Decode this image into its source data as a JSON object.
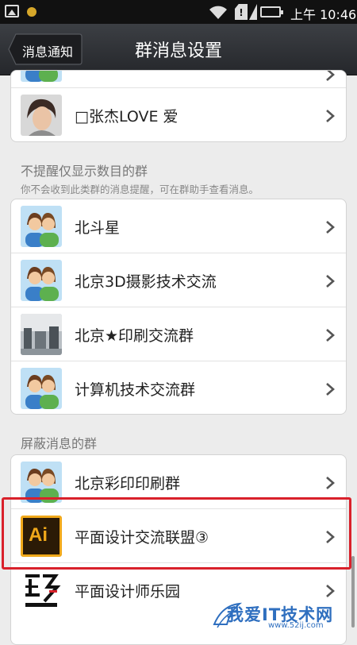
{
  "status_bar": {
    "time": "上午 10:46",
    "sim_label": "!"
  },
  "header": {
    "back_label": "消息通知",
    "title": "群消息设置"
  },
  "top_group": {
    "items": [
      {
        "label": "□张杰LOVE 爱",
        "avatar": "photo"
      }
    ]
  },
  "count_only_section": {
    "title": "不提醒仅显示数目的群",
    "description": "你不会收到此类群的消息提醒，可在群助手查看消息。",
    "items": [
      {
        "label": "北斗星",
        "avatar": "group-icon"
      },
      {
        "label": "北京3D摄影技术交流",
        "avatar": "group-icon"
      },
      {
        "label": "北京★印刷交流群",
        "avatar": "photo"
      },
      {
        "label": "计算机技术交流群",
        "avatar": "group-icon"
      }
    ]
  },
  "blocked_section": {
    "title": "屏蔽消息的群",
    "items": [
      {
        "label": "北京彩印印刷群",
        "avatar": "group-icon"
      },
      {
        "label": "平面设计交流联盟③",
        "avatar": "ai-logo",
        "avatar_text": "Ai"
      },
      {
        "label": "平面设计师乐园",
        "avatar": "logo"
      }
    ]
  },
  "watermark": {
    "text": "我爱IT技术网",
    "url": "www.52ij.com"
  },
  "colors": {
    "highlight": "#d9212b",
    "titlebar": "#2f3236"
  }
}
